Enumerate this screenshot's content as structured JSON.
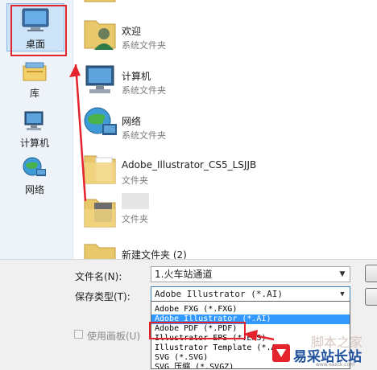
{
  "sidebar": {
    "items": [
      {
        "label": "桌面",
        "icon": "desktop-icon",
        "selected": true
      },
      {
        "label": "库",
        "icon": "library-icon"
      },
      {
        "label": "计算机",
        "icon": "computer-icon"
      },
      {
        "label": "网络",
        "icon": "network-icon"
      }
    ]
  },
  "files": [
    {
      "name": "",
      "type": ""
    },
    {
      "name": "欢迎",
      "type": "系统文件夹",
      "icon": "user-folder-icon"
    },
    {
      "name": "计算机",
      "type": "系统文件夹",
      "icon": "computer-icon"
    },
    {
      "name": "网络",
      "type": "系统文件夹",
      "icon": "network-icon"
    },
    {
      "name": "Adobe_Illustrator_CS5_LSJJB",
      "type": "文件夹",
      "icon": "folder-icon"
    },
    {
      "name": "",
      "type": "文件夹",
      "icon": "folder-icon"
    },
    {
      "name": "新建文件夹 (2)",
      "type": "",
      "icon": "folder-icon"
    }
  ],
  "form": {
    "filename_label": "文件名(N):",
    "filename_value": "1.火车站通道",
    "savetype_label": "保存类型(T):",
    "savetype_value": "Adobe Illustrator (*.AI)",
    "use_artboards_label": "使用画板(U)",
    "use_artboards_checked": false
  },
  "dropdown": {
    "options": [
      "Adobe FXG (*.FXG)",
      "Adobe Illustrator (*.AI)",
      "Adobe PDF (*.PDF)",
      "Illustrator EPS (*.EPS)",
      "Illustrator Template (*.AIT)",
      "SVG (*.SVG)",
      "SVG 压缩 (*.SVGZ)"
    ],
    "selected_index": 1
  },
  "watermark": {
    "line1": "脚本之家",
    "brand": "易采站长站",
    "url": "www.easck.com"
  },
  "colors": {
    "highlight": "#e5232d",
    "selection": "#3399ff",
    "sidebar_bg": "#eef3fa"
  }
}
